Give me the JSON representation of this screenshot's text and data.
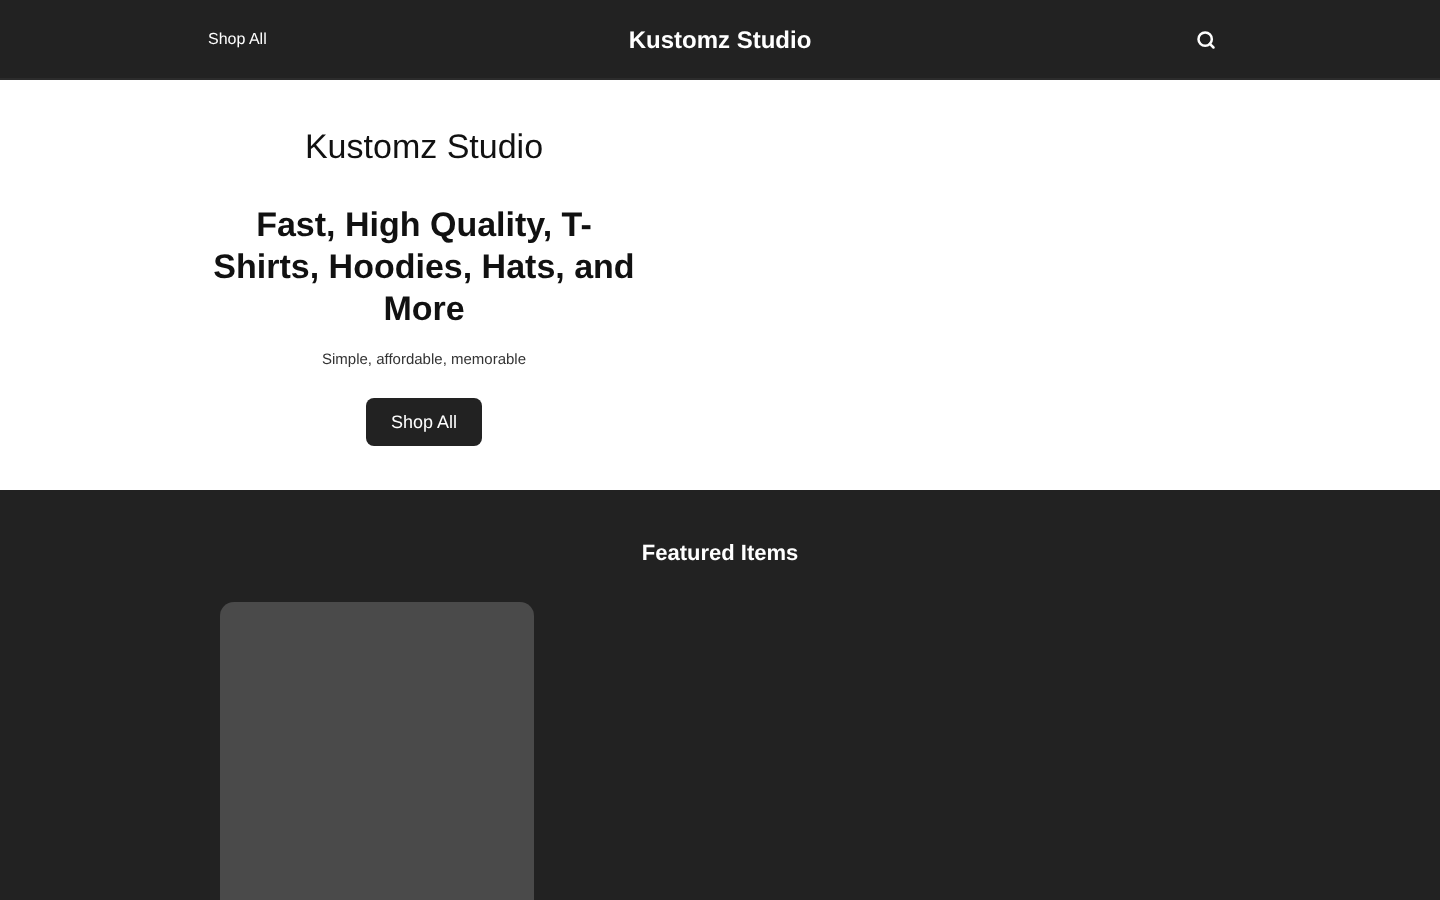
{
  "header": {
    "nav_link": "Shop All",
    "brand": "Kustomz Studio"
  },
  "hero": {
    "title": "Kustomz Studio",
    "headline": "Fast, High Quality, T-Shirts, Hoodies, Hats, and More",
    "tagline": "Simple, affordable, memorable",
    "button": "Shop All"
  },
  "featured": {
    "title": "Featured Items",
    "items": [
      {
        "kind": "placeholder"
      }
    ]
  }
}
